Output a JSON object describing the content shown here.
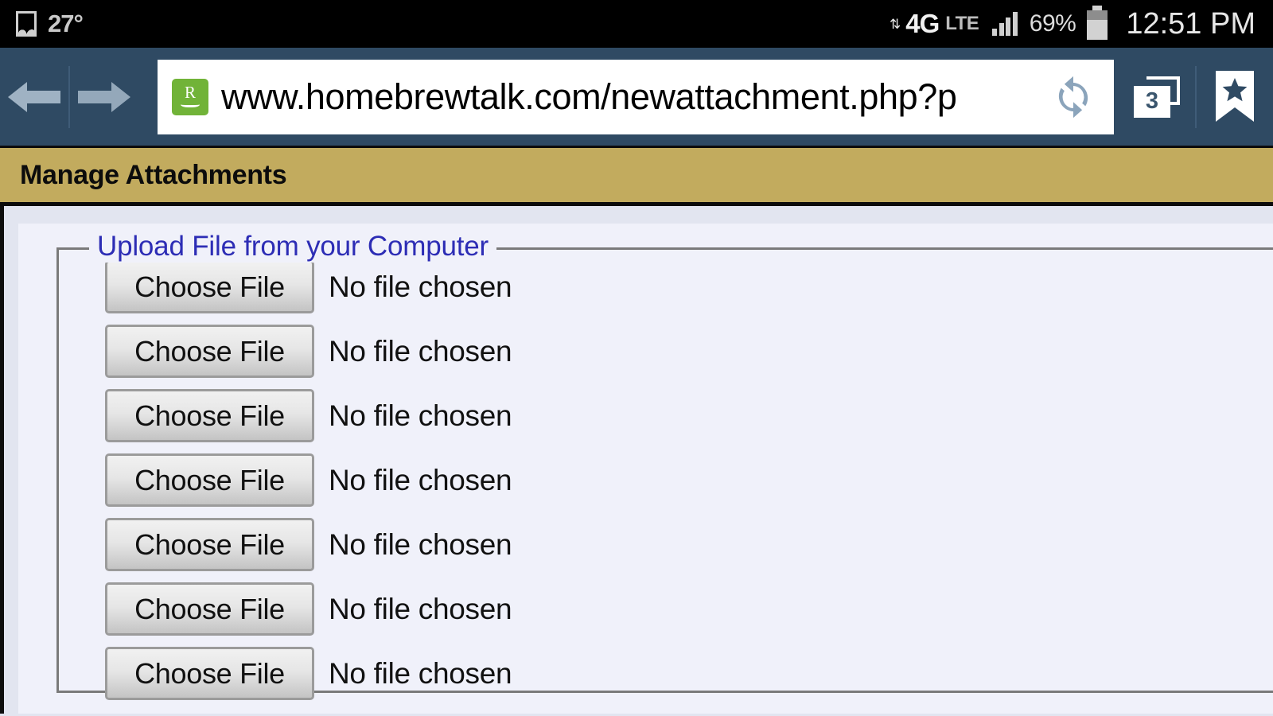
{
  "status_bar": {
    "gallery_icon": "image-icon",
    "temperature": "27°",
    "network_arrows": "⇅",
    "network_type_primary": "4G",
    "network_type_secondary": "LTE",
    "signal_icon": "signal-bars-icon",
    "battery_percent": "69%",
    "battery_icon": "battery-icon",
    "clock": "12:51 PM"
  },
  "browser": {
    "back_icon": "back-arrow-icon",
    "forward_icon": "forward-arrow-icon",
    "reader_icon": "reader-mode-icon",
    "reader_letter": "R",
    "url": "www.homebrewtalk.com/newattachment.php?p",
    "refresh_icon": "refresh-icon",
    "tab_count": "3",
    "tabs_icon": "tab-switcher-icon",
    "bookmark_icon": "bookmark-star-icon"
  },
  "page": {
    "title": "Manage Attachments",
    "fieldset_legend": "Upload File from your Computer",
    "file_rows": [
      {
        "button_label": "Choose File",
        "status": "No file chosen"
      },
      {
        "button_label": "Choose File",
        "status": "No file chosen"
      },
      {
        "button_label": "Choose File",
        "status": "No file chosen"
      },
      {
        "button_label": "Choose File",
        "status": "No file chosen"
      },
      {
        "button_label": "Choose File",
        "status": "No file chosen"
      },
      {
        "button_label": "Choose File",
        "status": "No file chosen"
      },
      {
        "button_label": "Choose File",
        "status": "No file chosen"
      }
    ]
  },
  "colors": {
    "status_bar_bg": "#000000",
    "browser_chrome": "#2f4a63",
    "page_header_gold": "#c2ab5e",
    "legend_blue": "#2d2db5",
    "reader_green": "#71b338",
    "page_bg": "#f0f1fa"
  }
}
